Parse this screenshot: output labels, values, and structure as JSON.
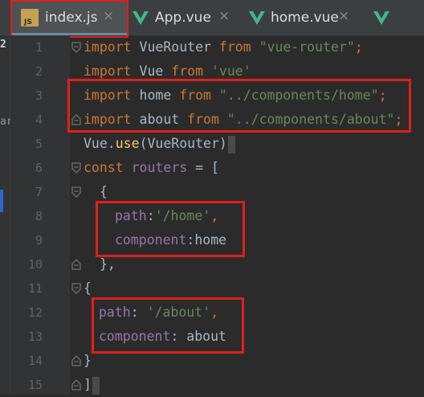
{
  "tabs": [
    {
      "label": "index.js",
      "close": "×",
      "icon": "js-file-icon",
      "icon_text": "JS",
      "active": true
    },
    {
      "label": "App.vue",
      "close": "×",
      "icon": "vue-file-icon"
    },
    {
      "label": "home.vue",
      "close": "×",
      "icon": "vue-file-icon"
    },
    {
      "label": "",
      "icon": "vue-file-icon"
    }
  ],
  "left_strip": {
    "top_text": "2",
    "mid_text": "ar"
  },
  "line_numbers": [
    "1",
    "2",
    "3",
    "4",
    "5",
    "6",
    "7",
    "8",
    "9",
    "10",
    "11",
    "12",
    "13",
    "14",
    "15"
  ],
  "code": {
    "l1": {
      "kw1": "import",
      "id": " VueRouter ",
      "kw2": "from",
      "s": " \"vue-router\"",
      "end": ";"
    },
    "l2": {
      "kw1": "import",
      "id": " Vue ",
      "kw2": "from",
      "s": " 'vue'"
    },
    "l3": {
      "kw1": "import",
      "id": " home ",
      "kw2": "from",
      "s": " \"../components/home\"",
      "end": ";"
    },
    "l4": {
      "kw1": "import",
      "id": " about ",
      "kw2": "from",
      "s": " \"../components/about\"",
      "end": ";"
    },
    "l5": {
      "obj": "Vue.",
      "fn": "use",
      "args": "(VueRouter)"
    },
    "l6": {
      "kw": "const",
      "id": " routers ",
      "rest": "= ["
    },
    "l7": {
      "text": "{"
    },
    "l8": {
      "prop": "path",
      "colon": ":",
      "s": "'/home'",
      "end": ","
    },
    "l9": {
      "prop": "component",
      "colon": ":",
      "id": "home"
    },
    "l10": {
      "text": "},"
    },
    "l11": {
      "text": "{"
    },
    "l12": {
      "prop": "path",
      "colon": ": ",
      "s": "'/about'",
      "end": ","
    },
    "l13": {
      "prop": "component",
      "colon": ": ",
      "id": "about"
    },
    "l14": {
      "text": "}"
    },
    "l15": {
      "text": "]"
    }
  },
  "colors": {
    "keyword": "#cc7832",
    "string": "#6a8759",
    "property": "#9876aa",
    "function": "#ffc66d",
    "text": "#a9b7c6",
    "background": "#2b2b2b",
    "highlight_box": "#e0201a"
  }
}
